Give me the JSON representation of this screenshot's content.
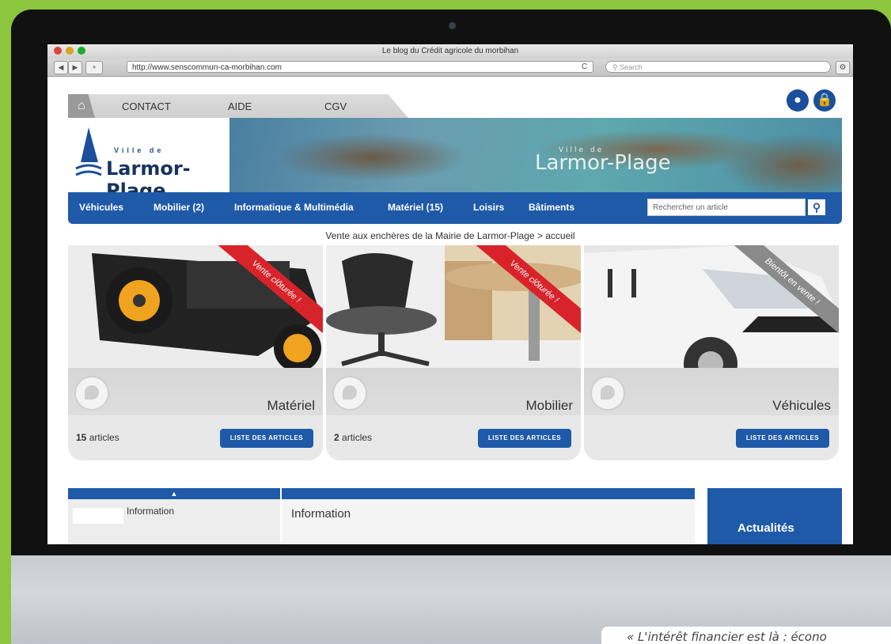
{
  "window": {
    "title": "Le blog du Crédit agricole du morbihan"
  },
  "toolbar": {
    "back": "◀",
    "forward": "▶",
    "add": "+",
    "url": "http://www.senscommun-ca-morbihan.com",
    "reload": "C",
    "search_placeholder": "Search",
    "gear": "⚙"
  },
  "site": {
    "top_tabs": [
      "CONTACT",
      "AIDE",
      "CGV"
    ],
    "logo_small": "Ville de",
    "logo_main": "Larmor-Plage",
    "nav": [
      "Véhicules",
      "Mobilier (2)",
      "Informatique & Multimédia",
      "Matériel (15)",
      "Loisirs",
      "Bâtiments"
    ],
    "search_placeholder": "Rechercher un article",
    "breadcrumb": "Vente aux enchères de la Mairie de Larmor-Plage > accueil"
  },
  "cards": [
    {
      "title": "Matériel",
      "count": "15",
      "count_label": " articles",
      "button": "LISTE DES ARTICLES",
      "ribbon": "Vente clôturée !",
      "ribbon_color": "#d8232a"
    },
    {
      "title": "Mobilier",
      "count": "2",
      "count_label": " articles",
      "button": "LISTE DES ARTICLES",
      "ribbon": "Vente clôturée !",
      "ribbon_color": "#d8232a"
    },
    {
      "title": "Véhicules",
      "count": "",
      "count_label": "",
      "button": "LISTE DES ARTICLES",
      "ribbon": "Bientôt en vente !",
      "ribbon_color": "#8a8a8a"
    }
  ],
  "bottom": {
    "left_info": "Information",
    "mid_info": "Information",
    "right_title": "Actualités"
  },
  "quote": "« L'intérêt financier est là : écono",
  "colors": {
    "accent": "#1f5aa8",
    "page_bg": "#8cc63f",
    "ribbon_red": "#d8232a"
  }
}
